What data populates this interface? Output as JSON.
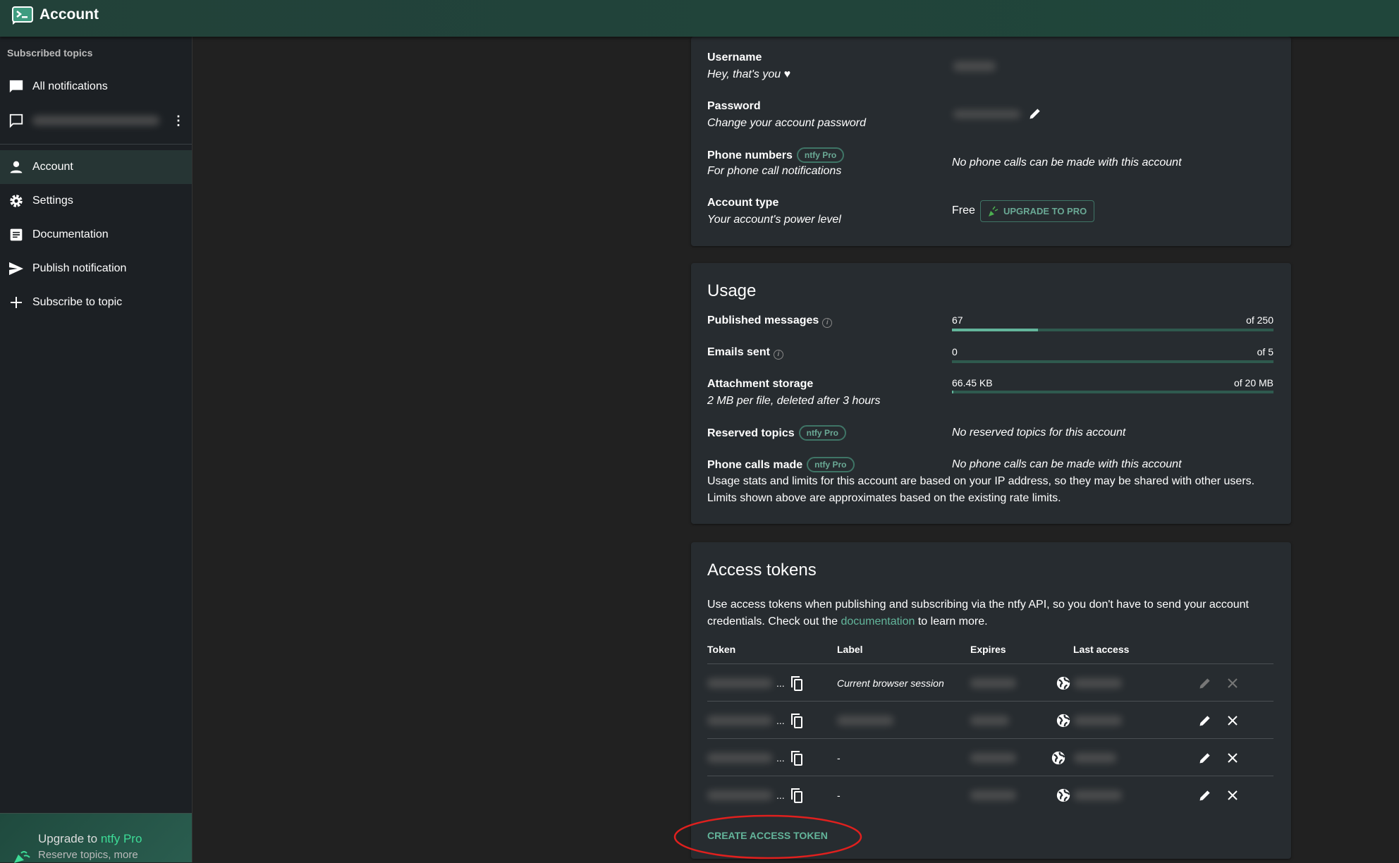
{
  "app": {
    "title": "Account",
    "accent": "#63b59b",
    "topbar_color": "#224139"
  },
  "sidebar": {
    "heading": "Subscribed topics",
    "items": [
      {
        "label": "All notifications",
        "icon": "chat-filled-icon"
      },
      {
        "label": "",
        "icon": "chat-outline-icon",
        "blurred": true
      },
      {
        "label": "Account",
        "icon": "person-icon",
        "active": true
      },
      {
        "label": "Settings",
        "icon": "gear-icon"
      },
      {
        "label": "Documentation",
        "icon": "article-icon"
      },
      {
        "label": "Publish notification",
        "icon": "send-icon"
      },
      {
        "label": "Subscribe to topic",
        "icon": "plus-icon"
      }
    ],
    "upgrade": {
      "prefix": "Upgrade to ",
      "brand": "ntfy Pro",
      "subtitle": "Reserve topics, more"
    }
  },
  "account": {
    "username": {
      "label": "Username",
      "sub": "Hey, that's you ♥"
    },
    "password": {
      "label": "Password",
      "sub": "Change your account password"
    },
    "phone": {
      "label": "Phone numbers",
      "badge": "ntfy Pro",
      "sub": "For phone call notifications",
      "value": "No phone calls can be made with this account"
    },
    "type": {
      "label": "Account type",
      "sub": "Your account's power level",
      "value": "Free",
      "upgrade_button": "UPGRADE TO PRO"
    }
  },
  "usage": {
    "title": "Usage",
    "messages": {
      "label": "Published messages",
      "value": "67",
      "limit": "of 250",
      "fraction": 0.268
    },
    "emails": {
      "label": "Emails sent",
      "value": "0",
      "limit": "of 5",
      "fraction": 0
    },
    "storage": {
      "label": "Attachment storage",
      "sub": "2 MB per file, deleted after 3 hours",
      "value": "66.45 KB",
      "limit": "of 20 MB",
      "fraction": 0.003
    },
    "reserved": {
      "label": "Reserved topics",
      "badge": "ntfy Pro",
      "value": "No reserved topics for this account"
    },
    "calls": {
      "label": "Phone calls made",
      "badge": "ntfy Pro",
      "value": "No phone calls can be made with this account"
    },
    "note1": "Usage stats and limits for this account are based on your IP address, so they may be shared with other users.",
    "note2": "Limits shown above are approximates based on the existing rate limits."
  },
  "tokens": {
    "title": "Access tokens",
    "desc1": "Use access tokens when publishing and subscribing via the ntfy API, so you don't have to send your account",
    "desc2_pre": "credentials. Check out the ",
    "desc2_link": "documentation",
    "desc2_post": " to learn more.",
    "headers": [
      "Token",
      "Label",
      "Expires",
      "Last access"
    ],
    "ellipsis": "...",
    "rows": [
      {
        "label": "Current browser session",
        "editable": false
      },
      {
        "label": "",
        "editable": true,
        "label_blurred": true
      },
      {
        "label": "-",
        "editable": true
      },
      {
        "label": "-",
        "editable": true
      }
    ],
    "create_button": "CREATE ACCESS TOKEN"
  }
}
